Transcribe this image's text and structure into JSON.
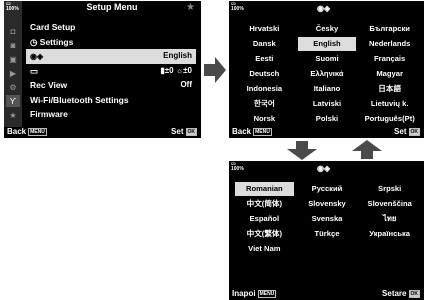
{
  "battery_label": "100%",
  "setup_menu": {
    "title": "Setup Menu",
    "items": [
      {
        "label": "Card Setup",
        "value": ""
      },
      {
        "label": "Settings",
        "value": ""
      },
      {
        "label": "",
        "value": "English"
      },
      {
        "label": "",
        "value": "±0 ☼±0"
      },
      {
        "label": "Rec View",
        "value": "Off"
      },
      {
        "label": "Wi-Fi/Bluetooth Settings",
        "value": ""
      },
      {
        "label": "Firmware",
        "value": ""
      }
    ],
    "footer_left": "Back",
    "footer_left_tag": "MENU",
    "footer_right": "Set",
    "footer_right_tag": "OK"
  },
  "language_page1": {
    "languages": [
      "Hrvatski",
      "Česky",
      "Български",
      "Dansk",
      "English",
      "Nederlands",
      "Eesti",
      "Suomi",
      "Français",
      "Deutsch",
      "Ελληνικά",
      "Magyar",
      "Indonesia",
      "Italiano",
      "日本語",
      "한국어",
      "Latviski",
      "Lietuvių k.",
      "Norsk",
      "Polski",
      "Português(Pt)"
    ],
    "selected": "English",
    "footer_left": "Back",
    "footer_left_tag": "MENU",
    "footer_right": "Set",
    "footer_right_tag": "OK"
  },
  "language_page2": {
    "languages": [
      "Romanian",
      "Русский",
      "Srpski",
      "中文(简体)",
      "Slovensky",
      "Slovenščina",
      "Español",
      "Svenska",
      "ไทย",
      "中文(繁体)",
      "Türkçe",
      "Українська",
      "Viet Nam"
    ],
    "selected": "Romanian",
    "footer_left": "Inapoi",
    "footer_left_tag": "MENU",
    "footer_right": "Setare",
    "footer_right_tag": "OK"
  },
  "colors": {
    "screen_bg": "#000000",
    "highlight": "#dcdcdc",
    "arrow": "#4a4a4a"
  }
}
